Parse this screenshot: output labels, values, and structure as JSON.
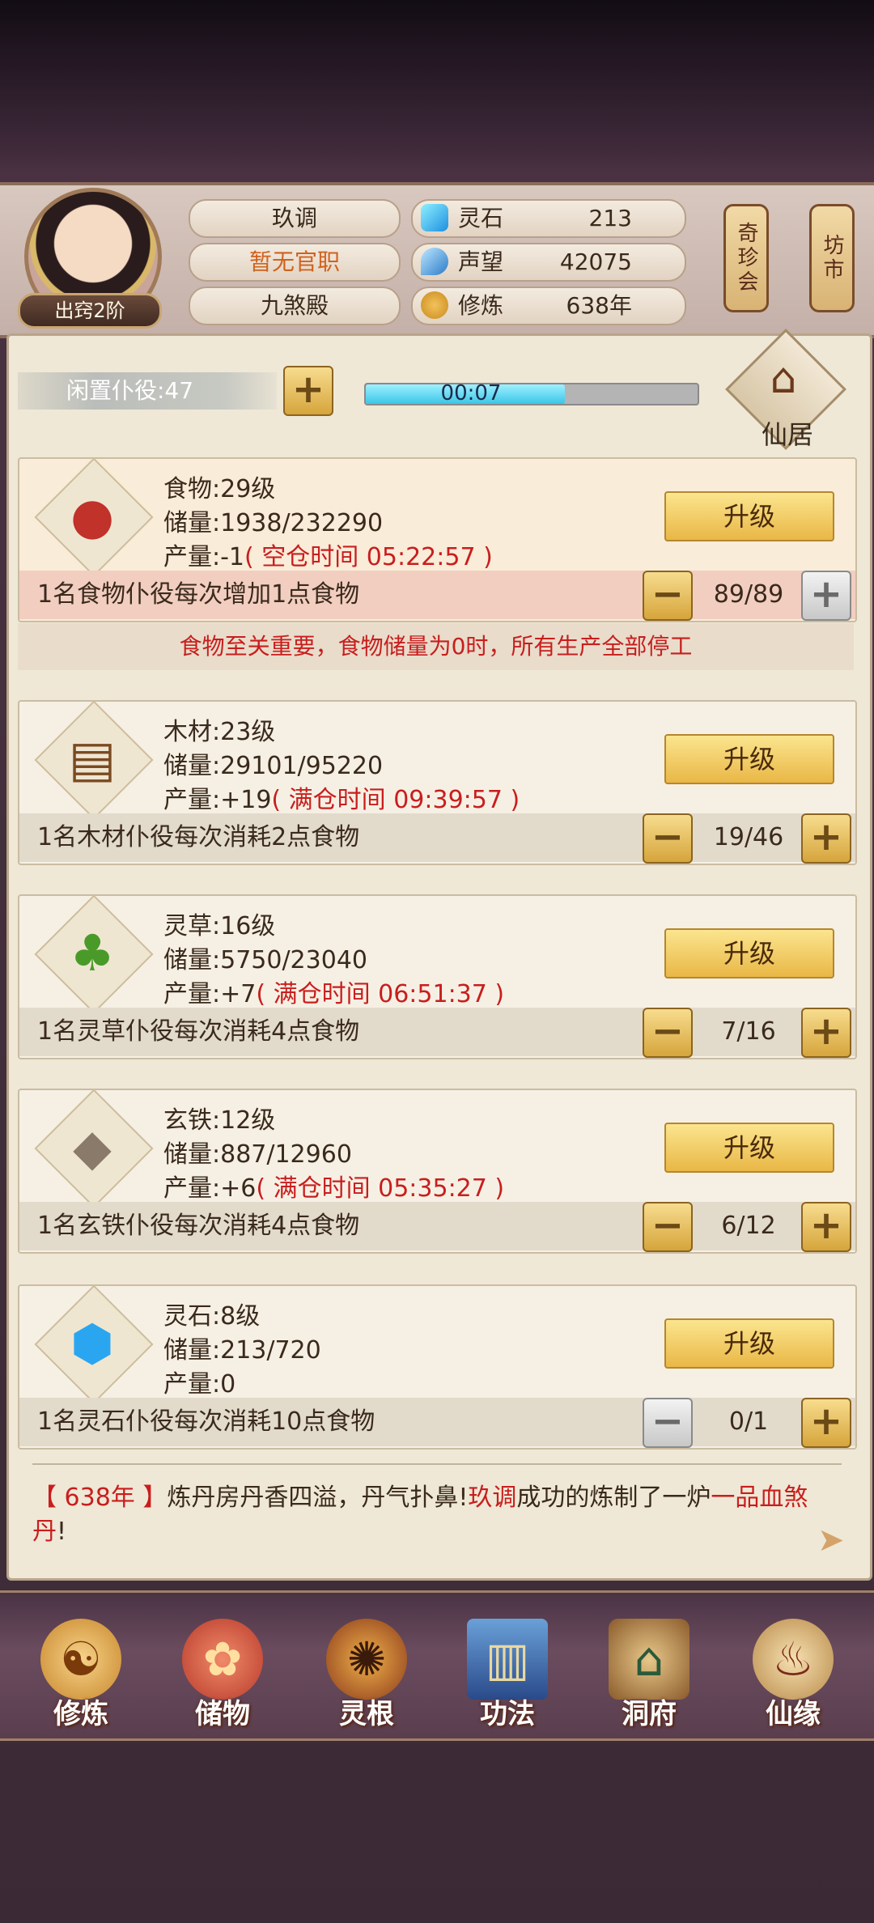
{
  "header": {
    "rank": "出窍2阶",
    "name": "玖调",
    "title": "暂无官职",
    "sect": "九煞殿",
    "resources": [
      {
        "icon": "spirit-stone-icon",
        "label": "灵石",
        "value": "213"
      },
      {
        "icon": "prestige-icon",
        "label": "声望",
        "value": "42075"
      },
      {
        "icon": "cultivation-icon",
        "label": "修炼",
        "value": "638年"
      }
    ],
    "side_buttons": [
      "奇珍会",
      "坊市"
    ]
  },
  "toolbar": {
    "idle_workers": "闲置仆役:47",
    "timer": "00:07",
    "timer_progress": 0.6,
    "xianju": "仙居"
  },
  "cards": [
    {
      "icon": "meat-icon",
      "level": "食物:29级",
      "storage": "储量:1938/232290",
      "production": "产量:-1",
      "production_note": "( 空仓时间 05:22:57 )",
      "upgrade": "升级",
      "worker_desc": "1名食物仆役每次增加1点食物",
      "count": "89/89"
    },
    {
      "icon": "wood-icon",
      "level": "木材:23级",
      "storage": "储量:29101/95220",
      "production": "产量:+19",
      "production_note": "( 满仓时间 09:39:57 )",
      "upgrade": "升级",
      "worker_desc": "1名木材仆役每次消耗2点食物",
      "count": "19/46"
    },
    {
      "icon": "herb-icon",
      "level": "灵草:16级",
      "storage": "储量:5750/23040",
      "production": "产量:+7",
      "production_note": "( 满仓时间 06:51:37 )",
      "upgrade": "升级",
      "worker_desc": "1名灵草仆役每次消耗4点食物",
      "count": "7/16"
    },
    {
      "icon": "iron-ore-icon",
      "level": "玄铁:12级",
      "storage": "储量:887/12960",
      "production": "产量:+6",
      "production_note": "( 满仓时间 05:35:27 )",
      "upgrade": "升级",
      "worker_desc": "1名玄铁仆役每次消耗4点食物",
      "count": "6/12"
    },
    {
      "icon": "crystal-icon",
      "level": "灵石:8级",
      "storage": "储量:213/720",
      "production": "产量:0",
      "production_note": "",
      "upgrade": "升级",
      "worker_desc": "1名灵石仆役每次消耗10点食物",
      "count": "0/1"
    }
  ],
  "warning": "食物至关重要，食物储量为0时，所有生产全部停工",
  "log": {
    "year": "【 638年 】",
    "text1": "炼丹房丹香四溢，丹气扑鼻!",
    "player": "玖调",
    "text2": "成功的炼制了一炉",
    "item": "一品血煞丹",
    "end": "!"
  },
  "nav": [
    {
      "icon": "meditation-icon",
      "label": "修炼"
    },
    {
      "icon": "bag-icon",
      "label": "储物"
    },
    {
      "icon": "spirit-root-icon",
      "label": "灵根"
    },
    {
      "icon": "book-icon",
      "label": "功法"
    },
    {
      "icon": "cave-mansion-icon",
      "label": "洞府"
    },
    {
      "icon": "gourd-icon",
      "label": "仙缘"
    }
  ],
  "colors": {
    "accent_red": "#c81e1e",
    "button_gold": "#e9b746",
    "progress_cyan": "#3cc6e6"
  }
}
